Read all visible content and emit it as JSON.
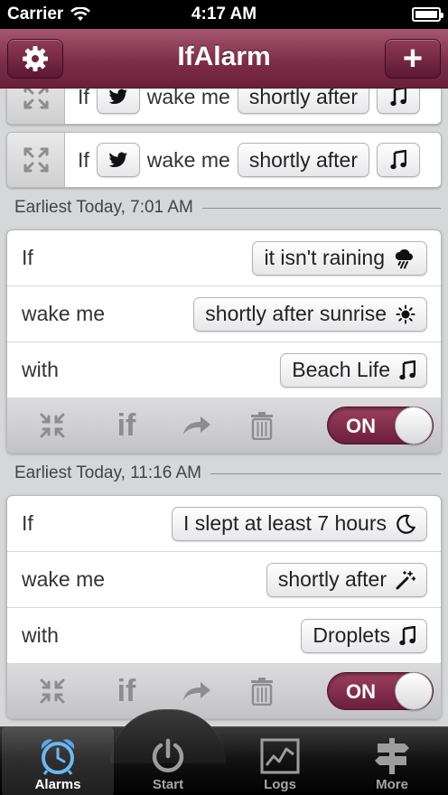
{
  "status_bar": {
    "carrier": "Carrier",
    "time": "4:17 AM"
  },
  "nav": {
    "title": "IfAlarm",
    "settings_icon": "gear-icon",
    "add_label": "+"
  },
  "collapsed_alarms": [
    {
      "if_label": "If",
      "trigger_icon": "twitter-icon",
      "wake_label": "wake me",
      "timing": "shortly after",
      "sound_icon": "music-note-icon"
    },
    {
      "if_label": "If",
      "trigger_icon": "twitter-icon",
      "wake_label": "wake me",
      "timing": "shortly after",
      "sound_icon": "music-note-icon"
    }
  ],
  "alarms": [
    {
      "header": "Earliest Today, 7:01 AM",
      "if_label": "If",
      "condition": "it isn't raining",
      "condition_icon": "rain-cloud-icon",
      "wake_label": "wake me",
      "timing": "shortly after sunrise",
      "timing_icon": "sun-icon",
      "with_label": "with",
      "sound": "Beach Life",
      "sound_icon": "music-note-icon",
      "toolbar": {
        "if_label": "if",
        "toggle": "ON"
      }
    },
    {
      "header": "Earliest Today, 11:16 AM",
      "if_label": "If",
      "condition": "I slept at least 7 hours",
      "condition_icon": "moon-icon",
      "wake_label": "wake me",
      "timing": "shortly after",
      "timing_icon": "magic-wand-icon",
      "with_label": "with",
      "sound": "Droplets",
      "sound_icon": "music-note-icon",
      "toolbar": {
        "if_label": "if",
        "toggle": "ON"
      }
    }
  ],
  "tabs": [
    {
      "label": "Alarms",
      "icon": "alarm-clock-icon",
      "active": true
    },
    {
      "label": "Start",
      "icon": "power-icon"
    },
    {
      "label": "Logs",
      "icon": "chart-icon"
    },
    {
      "label": "More",
      "icon": "signpost-icon"
    }
  ]
}
